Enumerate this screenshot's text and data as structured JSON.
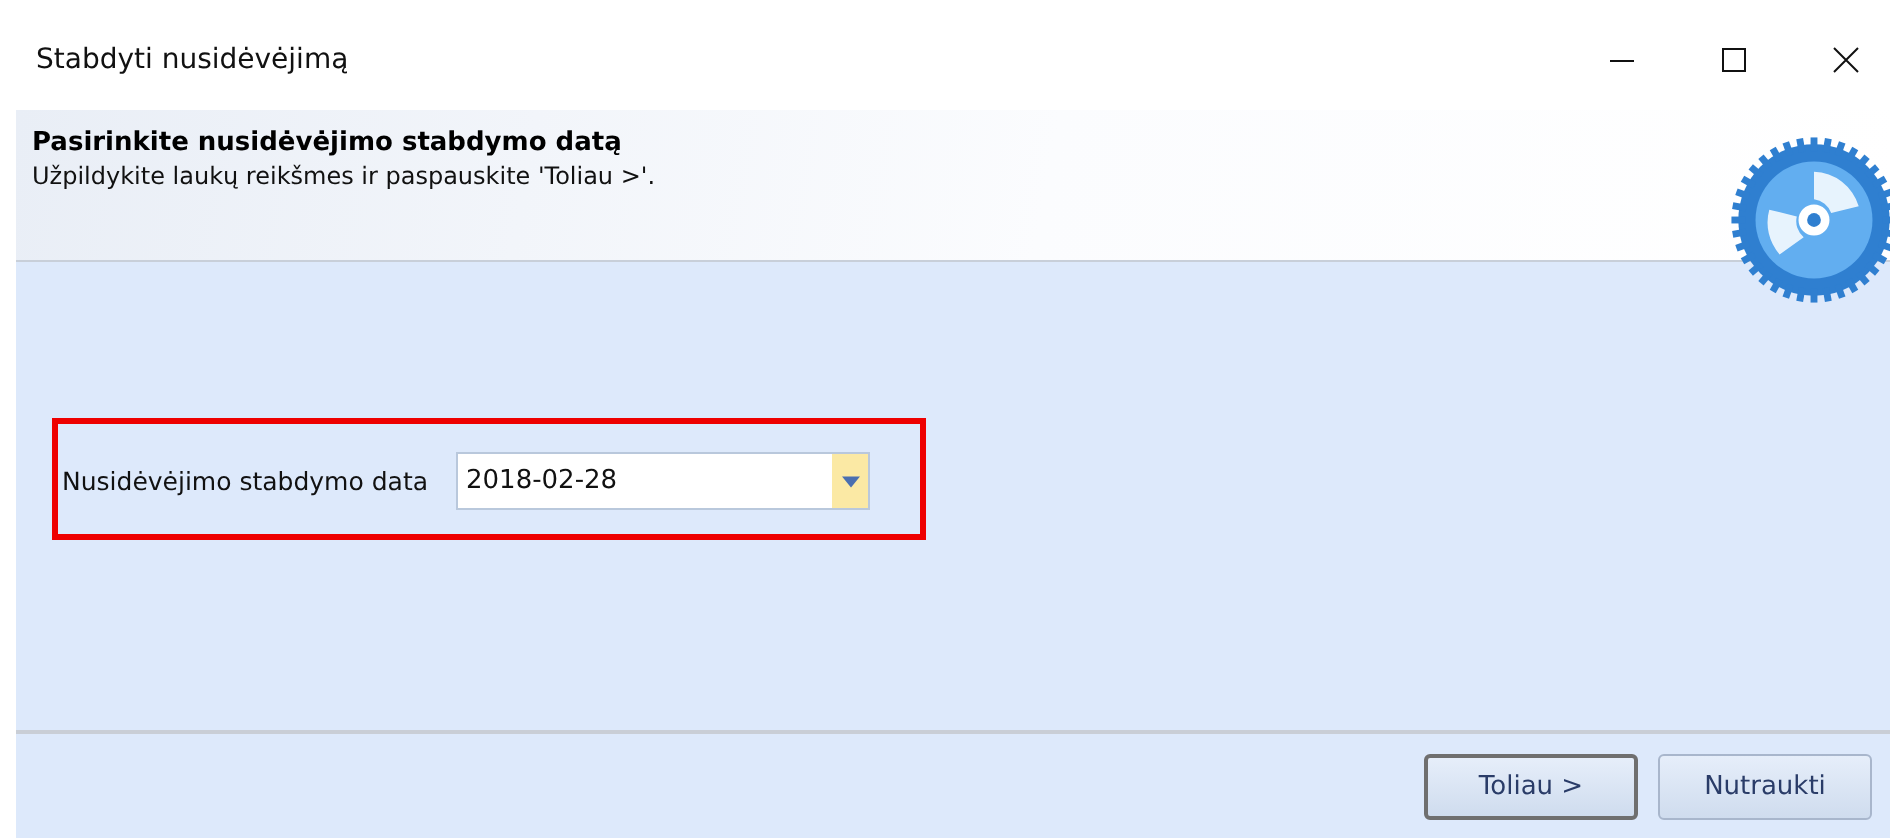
{
  "window": {
    "title": "Stabdyti nusidėvėjimą"
  },
  "header": {
    "title": "Pasirinkite nusidėvėjimo stabdymo datą",
    "subtitle": "Užpildykite laukų reikšmes ir paspauskite 'Toliau >'."
  },
  "form": {
    "label": "Nusidėvėjimo stabdymo data",
    "value": "2018-02-28",
    "highlighted": true
  },
  "buttons": [
    {
      "label": "Toliau >",
      "default": true
    },
    {
      "label": "Nutraukti",
      "default": false
    }
  ]
}
